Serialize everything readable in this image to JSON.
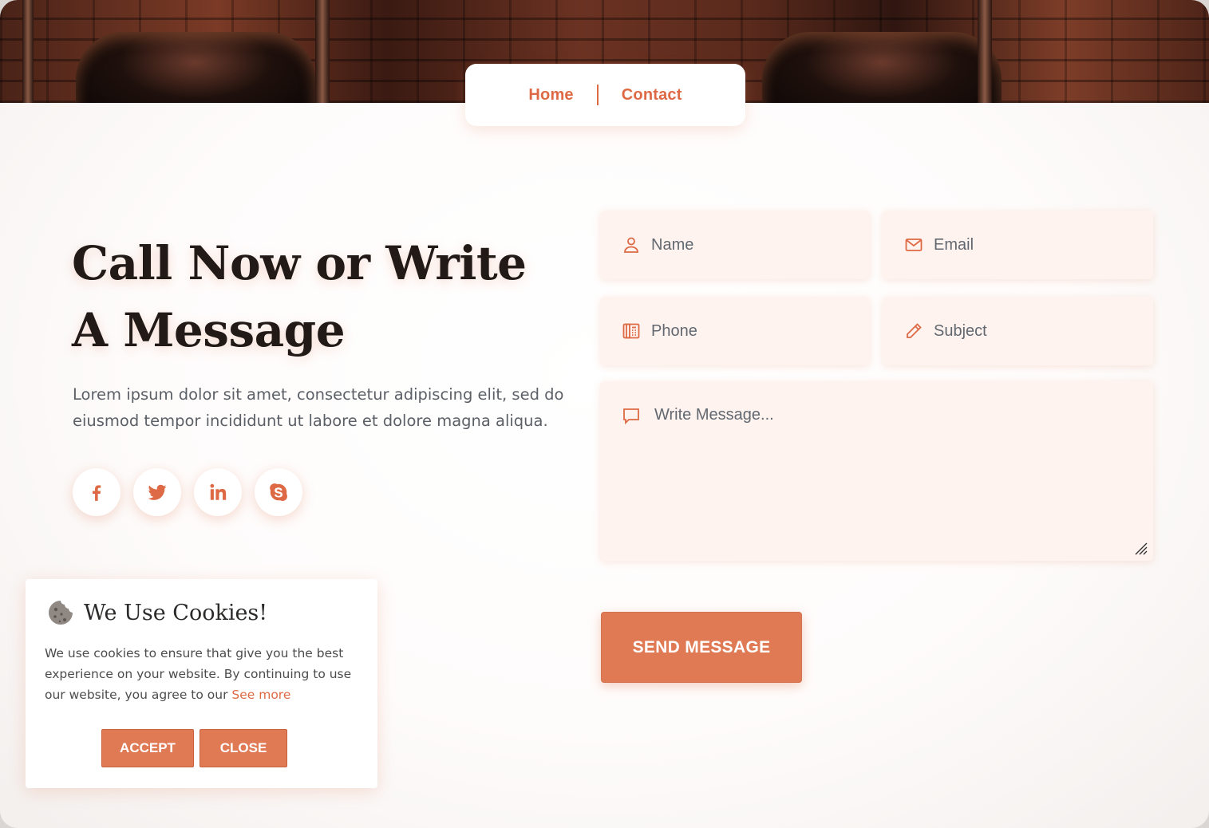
{
  "nav": {
    "items": [
      {
        "label": "Home"
      },
      {
        "label": "Contact"
      }
    ]
  },
  "hero": {
    "headline": "Call Now or Write A Message",
    "description": "Lorem ipsum dolor sit amet, consectetur adipiscing elit, sed do eiusmod tempor incididunt ut labore et dolore magna aliqua."
  },
  "socials": [
    {
      "name": "facebook-icon"
    },
    {
      "name": "twitter-icon"
    },
    {
      "name": "linkedin-icon"
    },
    {
      "name": "skype-icon"
    }
  ],
  "form": {
    "name_placeholder": "Name",
    "email_placeholder": "Email",
    "phone_placeholder": "Phone",
    "subject_placeholder": "Subject",
    "message_placeholder": "Write Message...",
    "submit_label": "SEND MESSAGE"
  },
  "cookie": {
    "title": "We Use Cookies!",
    "text": "We use cookies to ensure that give you the best experience on your website. By continuing to use our website, you agree to our",
    "link_label": "See more",
    "accept_label": "ACCEPT",
    "close_label": "CLOSE"
  },
  "colors": {
    "accent": "#e07a55",
    "heading": "#221a16",
    "body_text": "#5b5f66",
    "field_bg": "#fff3ef"
  }
}
